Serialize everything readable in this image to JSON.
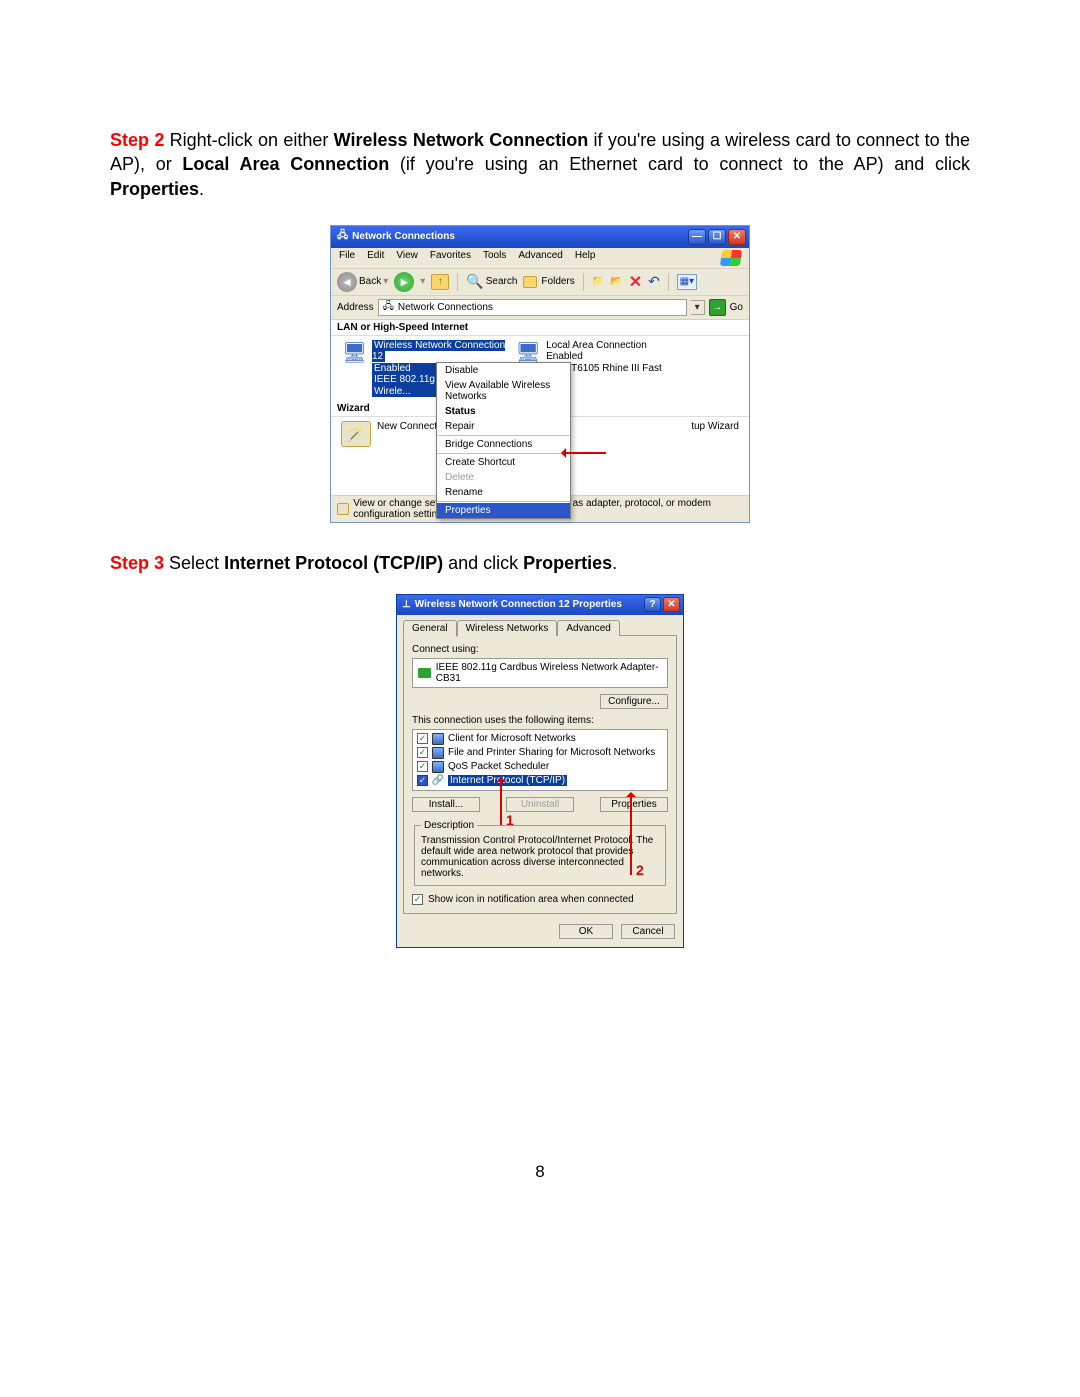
{
  "step2": {
    "label": "Step 2",
    "t1": " Right-click on either ",
    "b1": "Wireless Network Connection",
    "t2": " if you're using a wireless card to connect to the AP), or ",
    "b2": "Local Area Connection",
    "t3": " (if you're using an Ethernet card to connect to the AP) and click ",
    "b3": "Properties",
    "t4": "."
  },
  "step3": {
    "label": "Step 3",
    "t1": " Select ",
    "b1": "Internet Protocol (TCP/IP)",
    "t2": " and click ",
    "b2": "Properties",
    "t3": "."
  },
  "ss1": {
    "title": "Network Connections",
    "menus": [
      "File",
      "Edit",
      "View",
      "Favorites",
      "Tools",
      "Advanced",
      "Help"
    ],
    "toolbar": {
      "back": "Back",
      "search": "Search",
      "folders": "Folders"
    },
    "address": {
      "label": "Address",
      "value": "Network Connections",
      "go": "Go"
    },
    "cat1": "LAN or High-Speed Internet",
    "conn1": {
      "title": "Wireless Network Connection 12",
      "status": "Enabled",
      "device": "IEEE 802.11g Cardbus Wirele..."
    },
    "conn2": {
      "title": "Local Area Connection",
      "status": "Enabled",
      "device": "VIA VT6105 Rhine III Fast Eth..."
    },
    "cat2": "Wizard",
    "wizard": {
      "label": "New Connecti",
      "suffix": "tup Wizard"
    },
    "ctx": {
      "disable": "Disable",
      "view": "View Available Wireless Networks",
      "status": "Status",
      "repair": "Repair",
      "bridge": "Bridge Connections",
      "shortcut": "Create Shortcut",
      "delete": "Delete",
      "rename": "Rename",
      "properties": "Properties"
    },
    "statusbar": "View or change settings for this connection, such as adapter, protocol, or modem configuration settings."
  },
  "ss2": {
    "title": "Wireless Network Connection 12 Properties",
    "tabs": {
      "general": "General",
      "wireless": "Wireless Networks",
      "advanced": "Advanced"
    },
    "connect_using": "Connect using:",
    "adapter": "IEEE 802.11g Cardbus Wireless Network Adapter-CB31",
    "configure": "Configure...",
    "items_label": "This connection uses the following items:",
    "items": {
      "client": "Client for Microsoft Networks",
      "file": "File and Printer Sharing for Microsoft Networks",
      "qos": "QoS Packet Scheduler",
      "tcpip": "Internet Protocol (TCP/IP)"
    },
    "btns": {
      "install": "Install...",
      "uninstall": "Uninstall",
      "properties": "Properties"
    },
    "desc_fieldset": "Description",
    "desc_text": "Transmission Control Protocol/Internet Protocol. The default wide area network protocol that provides communication across diverse interconnected networks.",
    "show_icon": "Show icon in notification area when connected",
    "ok": "OK",
    "cancel": "Cancel",
    "annot": {
      "a1": "1",
      "a2": "2"
    }
  },
  "page_number": "8"
}
